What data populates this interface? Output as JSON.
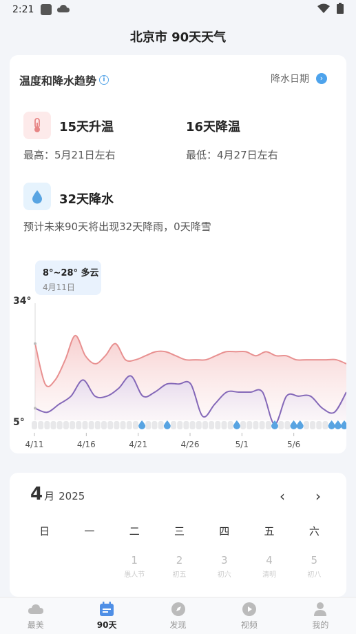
{
  "status_bar": {
    "time": "2:21"
  },
  "header": {
    "title": "北京市  90天天气"
  },
  "trend": {
    "title": "温度和降水趋势",
    "rain_dates_link": "降水日期",
    "warm": {
      "headline": "15天升温",
      "detail": "最高：5月21日左右"
    },
    "cool": {
      "headline": "16天降温",
      "detail": "最低：4月27日左右"
    },
    "rain": {
      "headline": "32天降水",
      "detail": "预计未来90天将出现32天降雨，0天降雪"
    },
    "tooltip": {
      "temps": "8°~28° 多云",
      "date": "4月11日"
    }
  },
  "chart_data": {
    "type": "line",
    "y_max_label": "34°",
    "y_min_label": "5°",
    "ylim": [
      5,
      34
    ],
    "x_tick_labels": [
      "4/11",
      "4/16",
      "4/21",
      "4/26",
      "5/1",
      "5/6"
    ],
    "colors": {
      "high": "#e89090",
      "low": "#8468b8",
      "rain": "#58a4e2",
      "dry": "#e8e8ea"
    },
    "series": [
      {
        "values": [
          24,
          14,
          15,
          20,
          26,
          21,
          19,
          21,
          24,
          20,
          20,
          21,
          22,
          22,
          21,
          20,
          20,
          20,
          21,
          22,
          22,
          22,
          21,
          22,
          21,
          21,
          20,
          20,
          20,
          20,
          20,
          19
        ]
      },
      {
        "values": [
          8,
          7,
          9,
          11,
          15,
          11,
          11,
          13,
          16,
          11,
          12,
          14,
          14,
          14,
          6,
          9,
          12,
          12,
          12,
          12,
          4,
          11,
          11,
          11,
          8,
          7,
          12
        ]
      }
    ],
    "rain_days": [
      0,
      0,
      0,
      0,
      0,
      0,
      0,
      0,
      0,
      0,
      0,
      0,
      0,
      0,
      0,
      0,
      0,
      1,
      0,
      0,
      0,
      1,
      0,
      0,
      0,
      0,
      0,
      0,
      0,
      0,
      0,
      0,
      1,
      0,
      0,
      0,
      0,
      0,
      1,
      0,
      0,
      1,
      1,
      0,
      0,
      0,
      0,
      1,
      1,
      1
    ]
  },
  "calendar": {
    "month_num": "4",
    "month_suffix": "月",
    "year": "2025",
    "prev": "‹",
    "next": "›",
    "weekdays": [
      "日",
      "一",
      "二",
      "三",
      "四",
      "五",
      "六"
    ],
    "days": [
      {
        "num": "",
        "lunar": ""
      },
      {
        "num": "",
        "lunar": ""
      },
      {
        "num": "1",
        "lunar": "愚人节"
      },
      {
        "num": "2",
        "lunar": "初五"
      },
      {
        "num": "3",
        "lunar": "初六"
      },
      {
        "num": "4",
        "lunar": "清明"
      },
      {
        "num": "5",
        "lunar": "初八"
      }
    ]
  },
  "nav": [
    {
      "label": "最美",
      "icon": "cloud-icon"
    },
    {
      "label": "90天",
      "icon": "calendar-icon"
    },
    {
      "label": "发现",
      "icon": "compass-icon"
    },
    {
      "label": "视频",
      "icon": "play-icon"
    },
    {
      "label": "我的",
      "icon": "person-icon"
    }
  ]
}
